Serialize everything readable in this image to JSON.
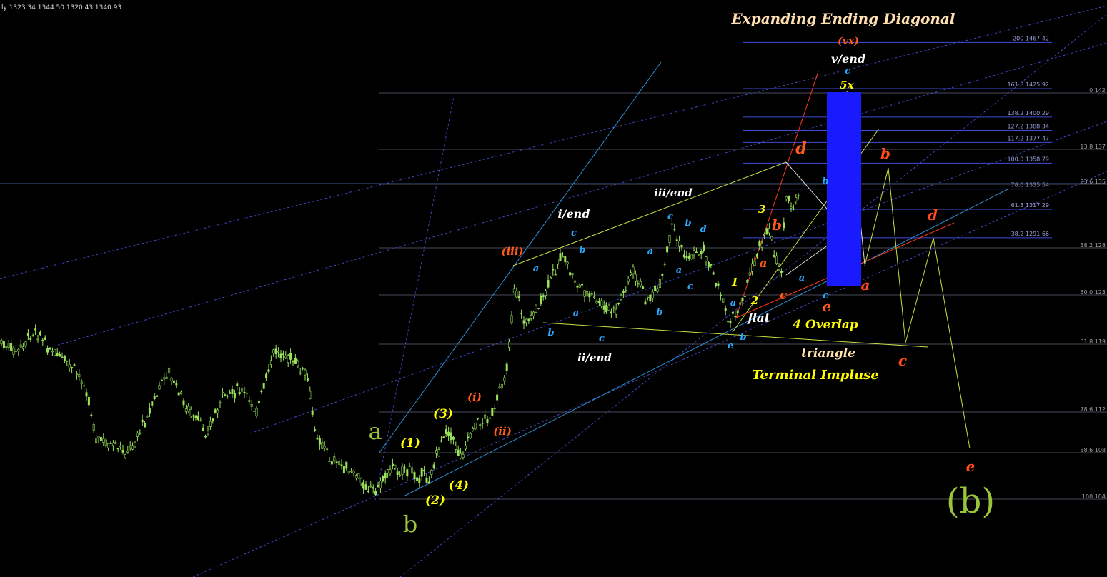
{
  "header": {
    "ohlc_text": "ly  1323.34  1344.50  1320.43  1340.93"
  },
  "colors": {
    "background": "#000000",
    "candle": "#9be35a",
    "fib": "#3c4dd8",
    "box": "#1a1aff"
  },
  "chart_data": {
    "type": "candlestick",
    "title": "Expanding Ending Diagonal",
    "xlabel": "",
    "ylabel": "",
    "ylim": [
      1040,
      1480
    ],
    "grid": false,
    "fib_levels": [
      {
        "ratio": "200",
        "price": 1467.42
      },
      {
        "ratio": "161.8",
        "price": 1425.92
      },
      {
        "ratio": "138.2",
        "price": 1400.29
      },
      {
        "ratio": "127.2",
        "price": 1388.34
      },
      {
        "ratio": "117.2",
        "price": 1377.47
      },
      {
        "ratio": "100.0",
        "price": 1358.79
      },
      {
        "ratio": "78.6",
        "price": 1335.54
      },
      {
        "ratio": "61.8",
        "price": 1317.29
      },
      {
        "ratio": "38.2",
        "price": 1291.66
      }
    ],
    "axis_ticks": [
      "0 142",
      "13.8 137",
      "23.6 135",
      "38.2 128",
      "50.0 123",
      "61.8 119",
      "78.6 112",
      "88.6 108",
      "100 104"
    ],
    "annotations": [
      {
        "text": "Expanding Ending Diagonal",
        "color": "#ffe0b0"
      },
      {
        "text": "(vx)",
        "color": "#ff5a1a"
      },
      {
        "text": "v/end",
        "color": "#ffffff"
      },
      {
        "text": "c",
        "color": "#29a8ff"
      },
      {
        "text": "5x",
        "color": "#ffff00"
      },
      {
        "text": "i/end",
        "color": "#ffffff"
      },
      {
        "text": "iii/end",
        "color": "#ffffff"
      },
      {
        "text": "ii/end",
        "color": "#ffffff"
      },
      {
        "text": "(iii)",
        "color": "#ff5a1a"
      },
      {
        "text": "(i)",
        "color": "#ff5a1a"
      },
      {
        "text": "(ii)",
        "color": "#ff5a1a"
      },
      {
        "text": "(1)",
        "color": "#ffff00"
      },
      {
        "text": "(2)",
        "color": "#ffff00"
      },
      {
        "text": "(3)",
        "color": "#ffff00"
      },
      {
        "text": "(4)",
        "color": "#ffff00"
      },
      {
        "text": "a",
        "color": "#9ac43a"
      },
      {
        "text": "b",
        "color": "#9ac43a"
      },
      {
        "text": "(b)",
        "color": "#9ac43a"
      },
      {
        "text": "flat",
        "color": "#ffffff"
      },
      {
        "text": "4 Overlap",
        "color": "#ffff00"
      },
      {
        "text": "triangle",
        "color": "#ffe0b0"
      },
      {
        "text": "Terminal Impluse",
        "color": "#ffff00"
      },
      {
        "text": "1",
        "color": "#ffff00"
      },
      {
        "text": "2",
        "color": "#ffff00"
      },
      {
        "text": "3",
        "color": "#ffff00"
      },
      {
        "text": "a",
        "color": "#ff5a1a"
      },
      {
        "text": "b",
        "color": "#ff5a1a"
      },
      {
        "text": "c",
        "color": "#ff5a1a"
      },
      {
        "text": "d",
        "color": "#ff5a1a"
      },
      {
        "text": "e",
        "color": "#ff5a1a"
      }
    ]
  }
}
